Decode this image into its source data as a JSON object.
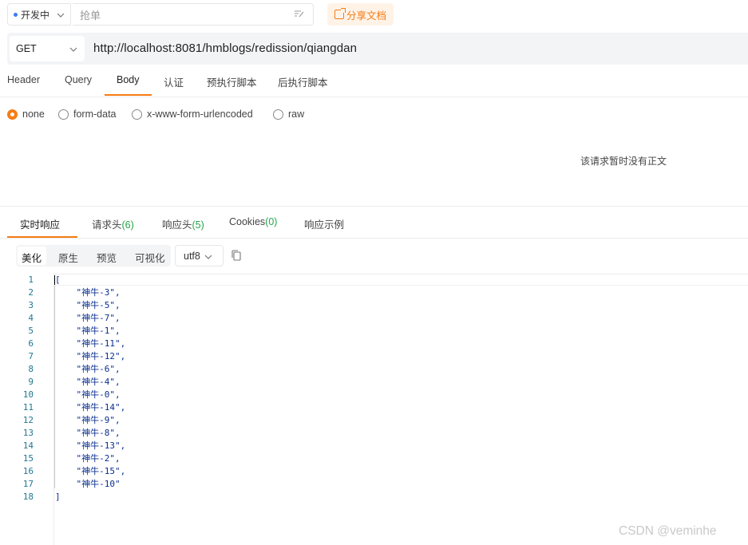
{
  "top_bar": {
    "environment": "开发中",
    "name_placeholder": "抢单",
    "share_label": "分享文档"
  },
  "request": {
    "method": "GET",
    "url": "http://localhost:8081/hmblogs/redission/qiangdan",
    "tabs": [
      "Header",
      "Query",
      "Body",
      "认证",
      "预执行脚本",
      "后执行脚本"
    ],
    "active_tab": "Body",
    "body_types": [
      "none",
      "form-data",
      "x-www-form-urlencoded",
      "raw"
    ],
    "selected_body_type": "none",
    "empty_body_text": "该请求暂时没有正文"
  },
  "response": {
    "tabs": [
      {
        "label": "实时响应",
        "count": ""
      },
      {
        "label": "请求头",
        "count": "(6)"
      },
      {
        "label": "响应头",
        "count": "(5)"
      },
      {
        "label": "Cookies",
        "count": "(0)"
      },
      {
        "label": "响应示例",
        "count": ""
      }
    ],
    "active_tab": "实时响应",
    "views": [
      "美化",
      "原生",
      "预览",
      "可视化"
    ],
    "active_view": "美化",
    "encoding": "utf8",
    "line_numbers": [
      "1",
      "2",
      "3",
      "4",
      "5",
      "6",
      "7",
      "8",
      "9",
      "10",
      "11",
      "12",
      "13",
      "14",
      "15",
      "16",
      "17",
      "18"
    ],
    "code_lines": [
      "[",
      "    \"神牛-3\",",
      "    \"神牛-5\",",
      "    \"神牛-7\",",
      "    \"神牛-1\",",
      "    \"神牛-11\",",
      "    \"神牛-12\",",
      "    \"神牛-6\",",
      "    \"神牛-4\",",
      "    \"神牛-0\",",
      "    \"神牛-14\",",
      "    \"神牛-9\",",
      "    \"神牛-8\",",
      "    \"神牛-13\",",
      "    \"神牛-2\",",
      "    \"神牛-15\",",
      "    \"神牛-10\"",
      "]"
    ]
  },
  "watermark": "CSDN @veminhe",
  "colors": {
    "accent": "#f57c14",
    "count_green": "#23a649",
    "env_dot": "#3b7cf6"
  }
}
